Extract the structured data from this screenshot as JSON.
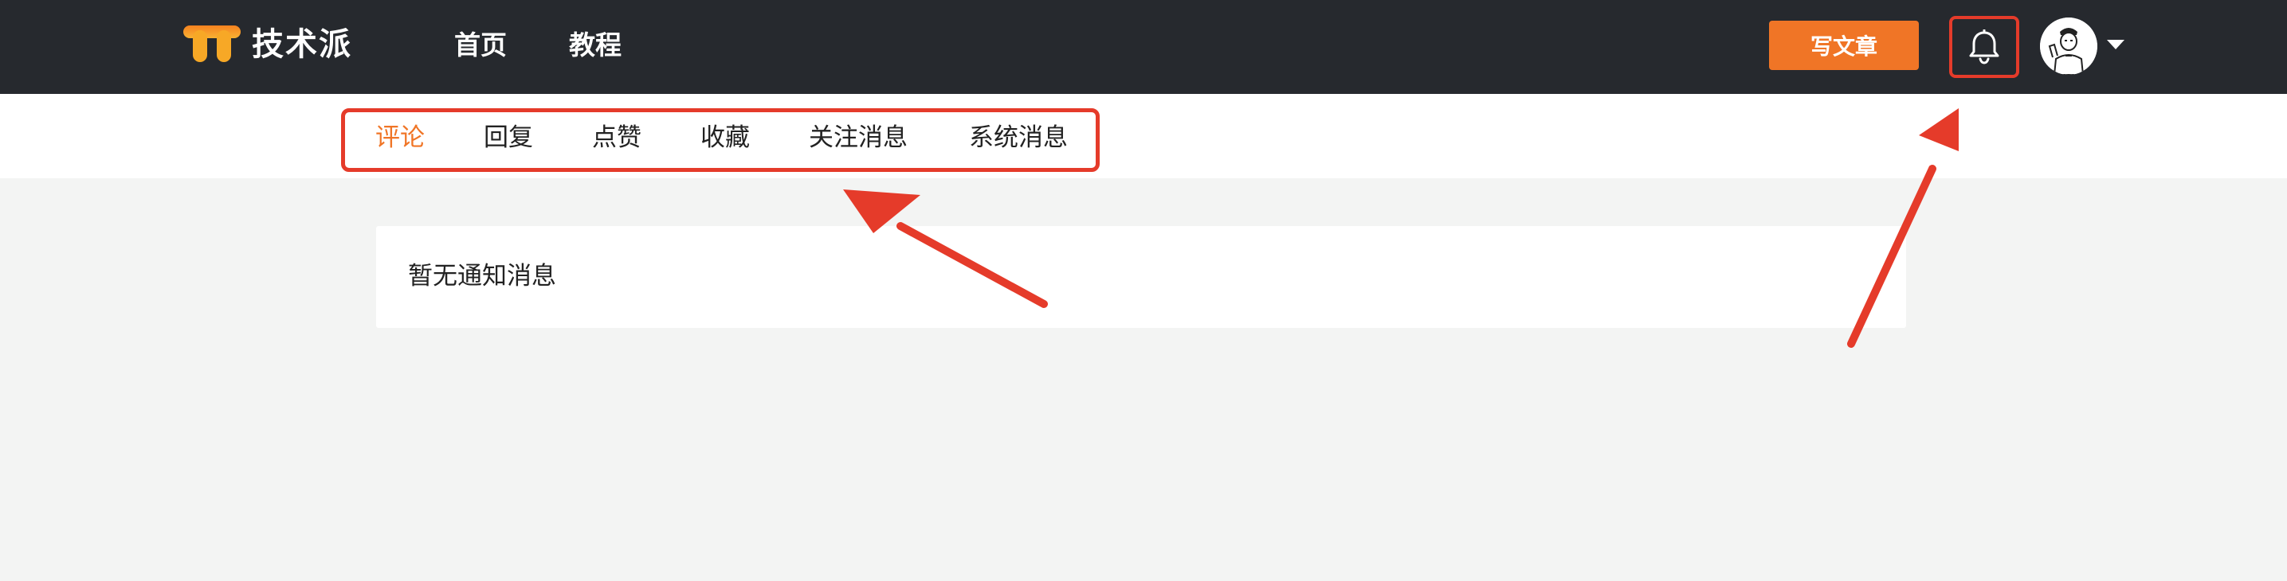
{
  "header": {
    "logo_text": "技术派",
    "nav": [
      {
        "label": "首页"
      },
      {
        "label": "教程"
      }
    ],
    "write_button_label": "写文章",
    "bell_icon": "bell-icon",
    "avatar_icon": "user-avatar",
    "dropdown_icon": "caret-down-icon"
  },
  "tabs": [
    {
      "label": "评论",
      "active": true
    },
    {
      "label": "回复"
    },
    {
      "label": "点赞"
    },
    {
      "label": "收藏"
    },
    {
      "label": "关注消息"
    },
    {
      "label": "系统消息"
    }
  ],
  "content": {
    "empty_message": "暂无通知消息"
  },
  "colors": {
    "header_bg": "#26292e",
    "accent": "#f07526",
    "annotation": "#e53b2a",
    "page_bg": "#f3f4f3"
  }
}
